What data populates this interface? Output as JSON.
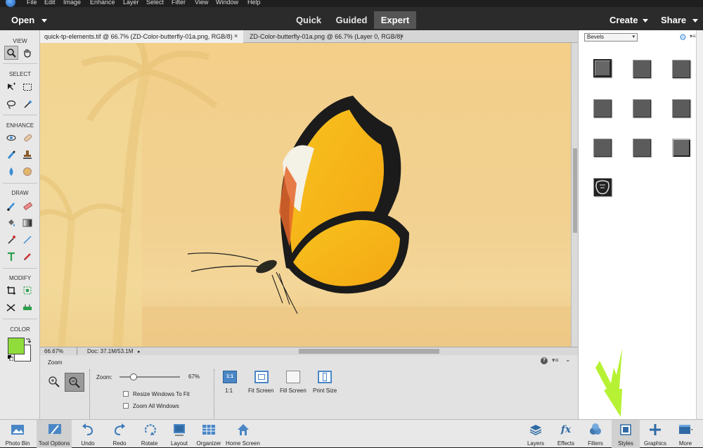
{
  "menu": [
    "File",
    "Edit",
    "Image",
    "Enhance",
    "Layer",
    "Select",
    "Filter",
    "View",
    "Window",
    "Help"
  ],
  "modebar": {
    "open": "Open",
    "modes": [
      "Quick",
      "Guided",
      "Expert"
    ],
    "active_mode": "Expert",
    "create": "Create",
    "share": "Share"
  },
  "toolbox": {
    "sections": [
      "VIEW",
      "SELECT",
      "ENHANCE",
      "DRAW",
      "MODIFY",
      "COLOR"
    ],
    "foreground_color": "#8fdc3a",
    "background_color": "#ffffff"
  },
  "tabs": [
    {
      "label": "quick-tp-elements.tif @ 66.7% (ZD-Color-butterfly-01a.png, RGB/8)",
      "active": true
    },
    {
      "label": "ZD-Color-butterfly-01a.png @ 66.7% (Layer 0, RGB/8)",
      "active": false
    }
  ],
  "status": {
    "zoom": "66.67%",
    "doc": "Doc: 37.1M/53.1M"
  },
  "tool_options": {
    "title": "Zoom",
    "zoom_label": "Zoom:",
    "zoom_value": "67%",
    "zoom_level": 0.67,
    "resize_windows": "Resize Windows To Fit",
    "zoom_all_windows": "Zoom All Windows",
    "buttons": [
      "1:1",
      "Fit Screen",
      "Fill Screen",
      "Print Size"
    ]
  },
  "right_panel": {
    "dropdown": "Bevels"
  },
  "taskbar_left": [
    "Photo Bin",
    "Tool Options",
    "Undo",
    "Redo",
    "Rotate",
    "Layout",
    "Organizer",
    "Home Screen"
  ],
  "taskbar_right": [
    "Layers",
    "Effects",
    "Filters",
    "Styles",
    "Graphics",
    "More"
  ],
  "colors": {
    "accent": "#3a8ed8",
    "annotation": "#b6f233"
  }
}
